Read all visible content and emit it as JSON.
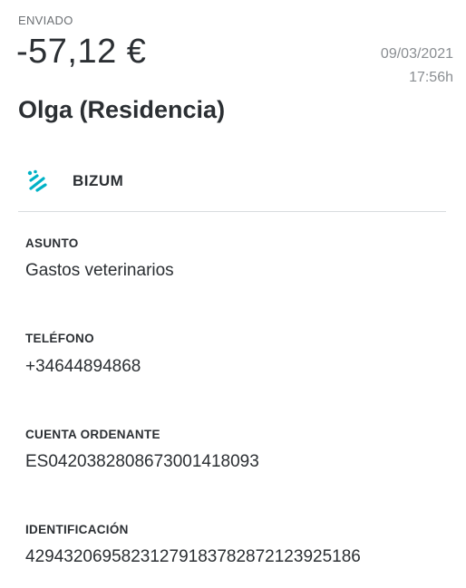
{
  "transaction": {
    "status": "ENVIADO",
    "amount": "-57,12 €",
    "date": "09/03/2021",
    "time": "17:56h",
    "recipient": "Olga (Residencia)"
  },
  "method": {
    "icon": "bizum-icon",
    "label": "BIZUM",
    "accent": "#00b2c6"
  },
  "fields": [
    {
      "label": "ASUNTO",
      "value": "Gastos veterinarios"
    },
    {
      "label": "TELÉFONO",
      "value": "+34644894868"
    },
    {
      "label": "CUENTA ORDENANTE",
      "value": "ES0420382808673001418093"
    },
    {
      "label": "IDENTIFICACIÓN",
      "value": "429432069582312791837828721239251​86"
    }
  ]
}
